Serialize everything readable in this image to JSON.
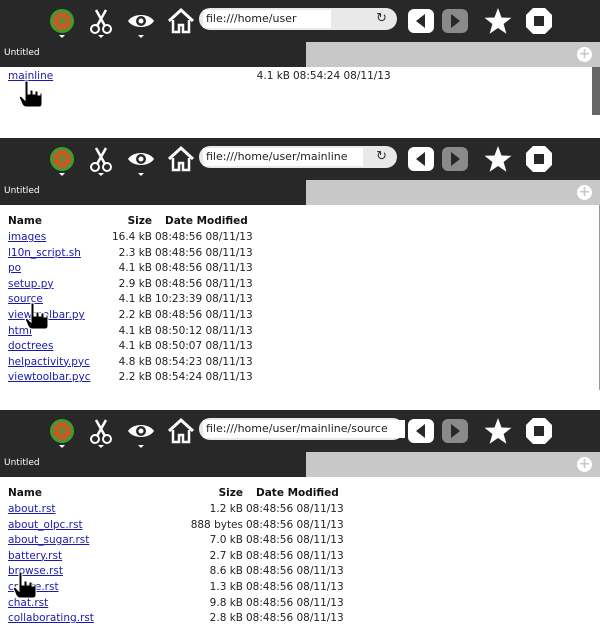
{
  "colors": {
    "toolbar": "#282828",
    "link": "#1a1ab0",
    "tab_strip": "#c8c8c8",
    "globe": "#e34b2a",
    "globe_ring": "#3aa02c"
  },
  "icons": [
    "globe-icon",
    "scissors-icon",
    "eye-icon",
    "home-icon",
    "back-icon",
    "forward-icon",
    "star-icon",
    "stop-icon",
    "reload-icon",
    "hand-cursor-icon"
  ],
  "panels": [
    {
      "url": "file:///home/user",
      "tab_label": "Untitled",
      "add_tab": "+",
      "headers": {
        "name": "",
        "size": "",
        "date": ""
      },
      "rows": [
        {
          "name": "mainline",
          "size": "4.1 kB",
          "date": "08:54:24 08/11/13"
        }
      ]
    },
    {
      "url": "file:///home/user/mainline",
      "tab_label": "Untitled",
      "add_tab": "+",
      "headers": {
        "name": "Name",
        "size": "Size",
        "date": "Date Modified"
      },
      "rows": [
        {
          "name": "images",
          "size": "16.4 kB",
          "date": "08:48:56 08/11/13"
        },
        {
          "name": "l10n_script.sh",
          "size": "2.3 kB",
          "date": "08:48:56 08/11/13"
        },
        {
          "name": "po",
          "size": "4.1 kB",
          "date": "08:48:56 08/11/13"
        },
        {
          "name": "setup.py",
          "size": "2.9 kB",
          "date": "08:48:56 08/11/13"
        },
        {
          "name": "source",
          "size": "4.1 kB",
          "date": "10:23:39 08/11/13"
        },
        {
          "name": "viewtoolbar.py",
          "size": "2.2 kB",
          "date": "08:48:56 08/11/13"
        },
        {
          "name": "html",
          "size": "4.1 kB",
          "date": "08:50:12 08/11/13"
        },
        {
          "name": "doctrees",
          "size": "4.1 kB",
          "date": "08:50:07 08/11/13"
        },
        {
          "name": "helpactivity.pyc",
          "size": "4.8 kB",
          "date": "08:54:23 08/11/13"
        },
        {
          "name": "viewtoolbar.pyc",
          "size": "2.2 kB",
          "date": "08:54:24 08/11/13"
        }
      ]
    },
    {
      "url": "file:///home/user/mainline/source",
      "tab_label": "Untitled",
      "add_tab": "+",
      "headers": {
        "name": "Name",
        "size": "Size",
        "date": "Date Modified"
      },
      "rows": [
        {
          "name": "about.rst",
          "size": "1.2 kB",
          "date": "08:48:56 08/11/13"
        },
        {
          "name": "about_olpc.rst",
          "size": "888 bytes",
          "date": "08:48:56 08/11/13"
        },
        {
          "name": "about_sugar.rst",
          "size": "7.0 kB",
          "date": "08:48:56 08/11/13"
        },
        {
          "name": "battery.rst",
          "size": "2.7 kB",
          "date": "08:48:56 08/11/13"
        },
        {
          "name": "browse.rst",
          "size": "8.6 kB",
          "date": "08:48:56 08/11/13"
        },
        {
          "name": "create.rst",
          "size": "1.3 kB",
          "date": "08:48:56 08/11/13"
        },
        {
          "name": "chat.rst",
          "size": "9.8 kB",
          "date": "08:48:56 08/11/13"
        },
        {
          "name": "collaborating.rst",
          "size": "2.8 kB",
          "date": "08:48:56 08/11/13"
        }
      ]
    }
  ]
}
